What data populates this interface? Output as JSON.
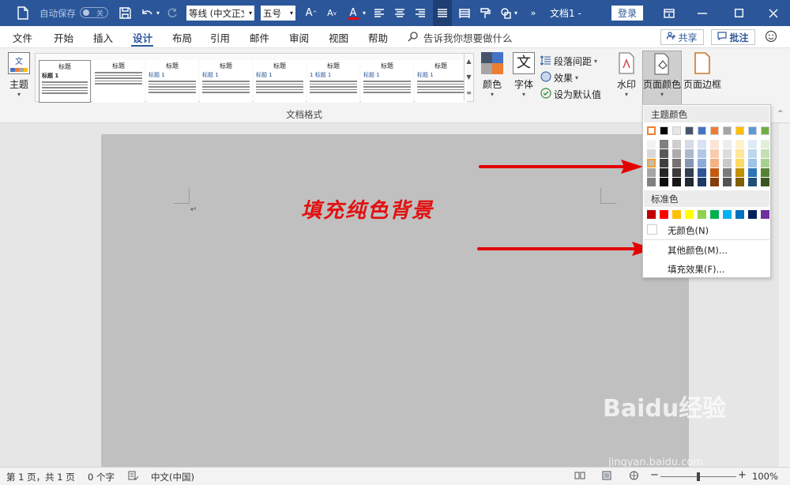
{
  "titlebar": {
    "autosave_label": "自动保存",
    "autosave_state": "关",
    "font_name": "等线 (中文正文)",
    "font_size": "五号",
    "doc_title": "文档1 -",
    "login_label": "登录",
    "more_symbol": "»"
  },
  "tabs": [
    "文件",
    "开始",
    "插入",
    "设计",
    "布局",
    "引用",
    "邮件",
    "审阅",
    "视图",
    "帮助"
  ],
  "active_tab": "设计",
  "tell_me": "告诉我你想要做什么",
  "share_label": "共享",
  "comment_label": "批注",
  "ribbon": {
    "theme_label": "主题",
    "gallery_group_label": "文档格式",
    "gallery": [
      {
        "title": "标题",
        "sub": "标题 1"
      },
      {
        "title": "标题",
        "sub": ""
      },
      {
        "title": "标题",
        "sub": "标题 1"
      },
      {
        "title": "标题",
        "sub": "标题 1"
      },
      {
        "title": "标题",
        "sub": "标题 1"
      },
      {
        "title": "标题",
        "sub": "1 标题 1"
      },
      {
        "title": "标题",
        "sub": "标题 1"
      },
      {
        "title": "标题",
        "sub": "标题 1"
      }
    ],
    "colors_label": "颜色",
    "fonts_label": "字体",
    "font_glyph": "文",
    "para_spacing_label": "段落间距",
    "effects_label": "效果",
    "set_default_label": "设为默认值",
    "watermark_label": "水印",
    "page_color_label": "页面颜色",
    "page_borders_label": "页面边框"
  },
  "document": {
    "annotation_text": "填充纯色背景",
    "paragraph_mark": "↵"
  },
  "dropdown": {
    "theme_colors_label": "主题颜色",
    "theme_top": [
      "#ffffff",
      "#000000",
      "#e7e6e6",
      "#44546a",
      "#4472c4",
      "#ed7d31",
      "#a5a5a5",
      "#ffc000",
      "#5b9bd5",
      "#70ad47"
    ],
    "theme_shades": [
      [
        "#f2f2f2",
        "#d9d9d9",
        "#bfbfbf",
        "#a6a6a6",
        "#808080"
      ],
      [
        "#7f7f7f",
        "#595959",
        "#404040",
        "#262626",
        "#0d0d0d"
      ],
      [
        "#d0cece",
        "#aeabab",
        "#757171",
        "#3b3838",
        "#161616"
      ],
      [
        "#d6dce5",
        "#adb9ca",
        "#8497b0",
        "#333f50",
        "#222a35"
      ],
      [
        "#d9e2f3",
        "#b4c6e7",
        "#8eaadb",
        "#2f5597",
        "#1f3864"
      ],
      [
        "#fbe5d6",
        "#f8cbad",
        "#f4b183",
        "#c55a11",
        "#843c0c"
      ],
      [
        "#ededed",
        "#dbdbdb",
        "#c9c9c9",
        "#7b7b7b",
        "#525252"
      ],
      [
        "#fff2cc",
        "#ffe699",
        "#ffd966",
        "#bf9000",
        "#7f6000"
      ],
      [
        "#deebf7",
        "#bdd7ee",
        "#9dc3e6",
        "#2e75b6",
        "#1f4e79"
      ],
      [
        "#e2f0d9",
        "#c5e0b4",
        "#a9d18e",
        "#548235",
        "#385723"
      ]
    ],
    "standard_colors_label": "标准色",
    "standard": [
      "#c00000",
      "#ff0000",
      "#ffc000",
      "#ffff00",
      "#92d050",
      "#00b050",
      "#00b0f0",
      "#0070c0",
      "#002060",
      "#7030a0"
    ],
    "no_color_label": "无颜色(N)",
    "more_colors_label": "其他颜色(M)...",
    "fill_effects_label": "填充效果(F)..."
  },
  "status": {
    "page_info": "第 1 页，共 1 页",
    "word_count": "0 个字",
    "language": "中文(中国)",
    "zoom": "100%"
  },
  "watermark_text": "Baidu经验",
  "watermark_url": "jingyan.baidu.com"
}
